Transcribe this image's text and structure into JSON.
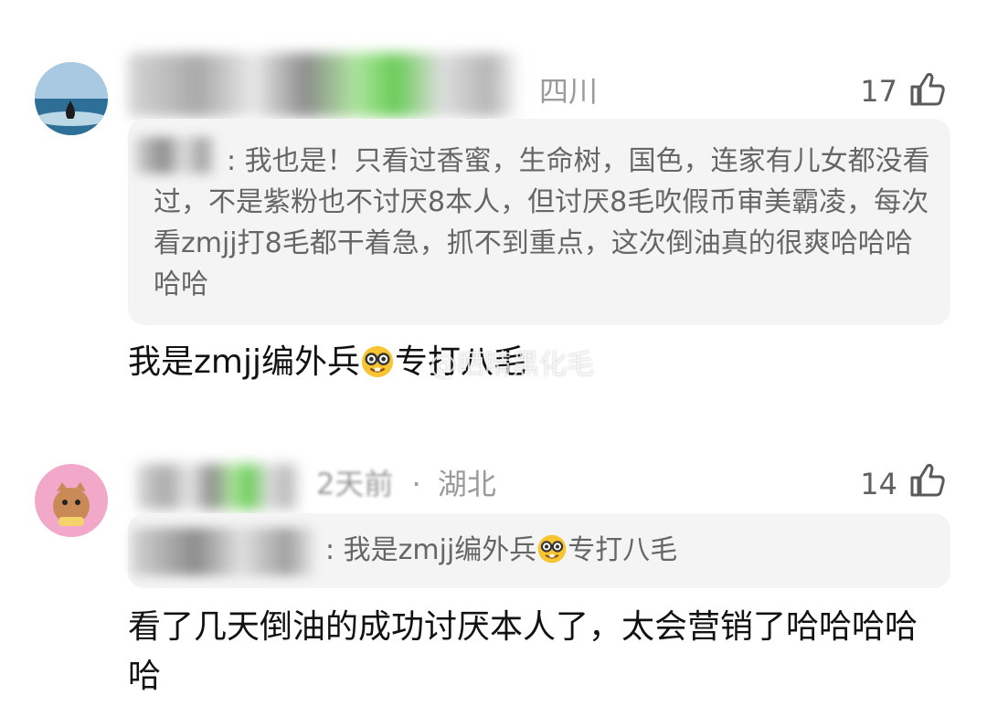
{
  "comments": [
    {
      "location": "四川",
      "like_count": "17",
      "quote_text": ": 我也是！只看过香蜜，生命树，国色，连家有儿女都没看过，不是紫粉也不讨厌8本人，但讨厌8毛吹假币审美霸凌，每次看zmjj打8毛都干着急，抓不到重点，这次倒油真的很爽哈哈哈哈哈",
      "body_before_emoji": "我是zmjj编外兵",
      "body_after_emoji": "专打八毛",
      "watermark": "@晒晴黑化毛"
    },
    {
      "time": "2天前",
      "separator": "·",
      "location": "湖北",
      "like_count": "14",
      "quote_before_emoji": ": 我是zmjj编外兵",
      "quote_after_emoji": "专打八毛",
      "body_text": "看了几天倒油的成功讨厌本人了，太会营销了哈哈哈哈哈"
    }
  ],
  "icons": {
    "like": "thumbs-up-icon",
    "emoji": "nerd-face-emoji-icon"
  },
  "colors": {
    "meta": "#9a9a9a",
    "quote_bg": "#f4f4f4",
    "body": "#111111"
  }
}
